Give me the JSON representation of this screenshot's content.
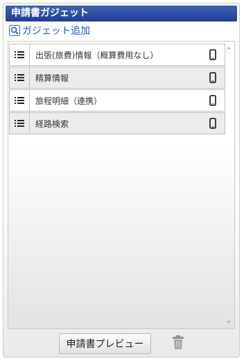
{
  "panel": {
    "title": "申請書ガジェット",
    "add_gadget_label": "ガジェット追加",
    "preview_button_label": "申請書プレビュー"
  },
  "gadgets": [
    {
      "label": "出張(旅費)情報（概算費用なし）",
      "icon": "mobile-icon"
    },
    {
      "label": "精算情報",
      "icon": "mobile-icon"
    },
    {
      "label": "旅程明細（連携）",
      "icon": "mobile-icon"
    },
    {
      "label": "経路検索",
      "icon": "mobile-icon"
    }
  ],
  "icons": {
    "add": "magnifier-icon",
    "drag": "list-handle-icon",
    "delete": "trash-icon"
  },
  "colors": {
    "title_bar": "#2a4ba6",
    "link": "#1b56c6",
    "alt_row": "#ececec"
  }
}
